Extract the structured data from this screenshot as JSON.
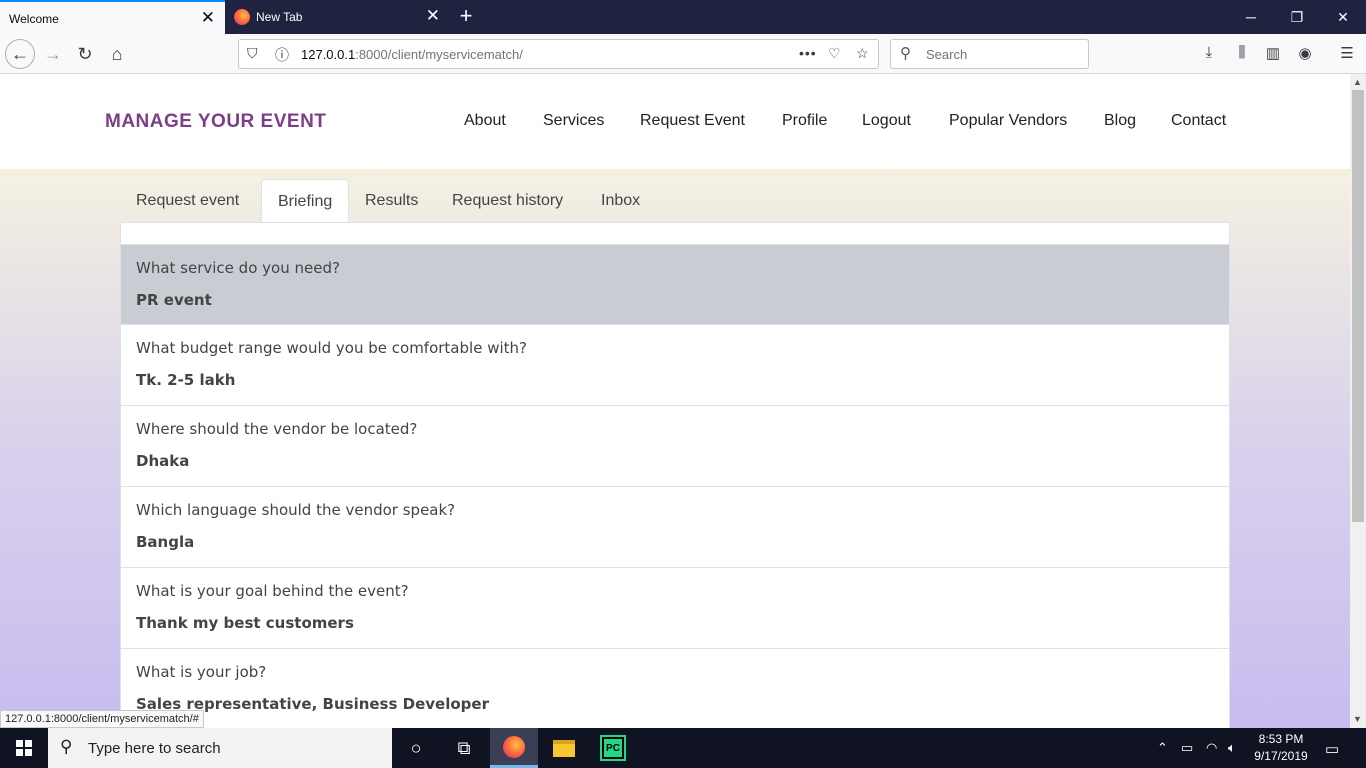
{
  "browser": {
    "tabs": [
      {
        "title": "Welcome",
        "active": true
      },
      {
        "title": "New Tab",
        "active": false
      }
    ],
    "url_host": "127.0.0.1",
    "url_rest": ":8000/client/myservicematch/",
    "search_placeholder": "Search",
    "status_link": "127.0.0.1:8000/client/myservicematch/#"
  },
  "site": {
    "brand": "MANAGE YOUR EVENT",
    "nav": [
      "About",
      "Services",
      "Request Event",
      "Profile",
      "Logout",
      "Popular Vendors",
      "Blog",
      "Contact"
    ]
  },
  "page_tabs": {
    "items": [
      "Request event",
      "Briefing",
      "Results",
      "Request history",
      "Inbox"
    ],
    "active": "Briefing"
  },
  "briefing": [
    {
      "question": "What service do you need?",
      "answer": "PR event",
      "highlighted": true
    },
    {
      "question": "What budget range would you be comfortable with?",
      "answer": "Tk. 2-5 lakh"
    },
    {
      "question": "Where should the vendor be located?",
      "answer": "Dhaka"
    },
    {
      "question": "Which language should the vendor speak?",
      "answer": "Bangla"
    },
    {
      "question": "What is your goal behind the event?",
      "answer": "Thank my best customers"
    },
    {
      "question": "What is your job?",
      "answer": "Sales representative, Business Developer"
    }
  ],
  "taskbar": {
    "search_placeholder": "Type here to search",
    "time": "8:53 PM",
    "date": "9/17/2019"
  },
  "colors": {
    "brand": "#7b3f86",
    "highlight_row": "#c9ccd2",
    "tab_accent": "#0a84ff"
  }
}
